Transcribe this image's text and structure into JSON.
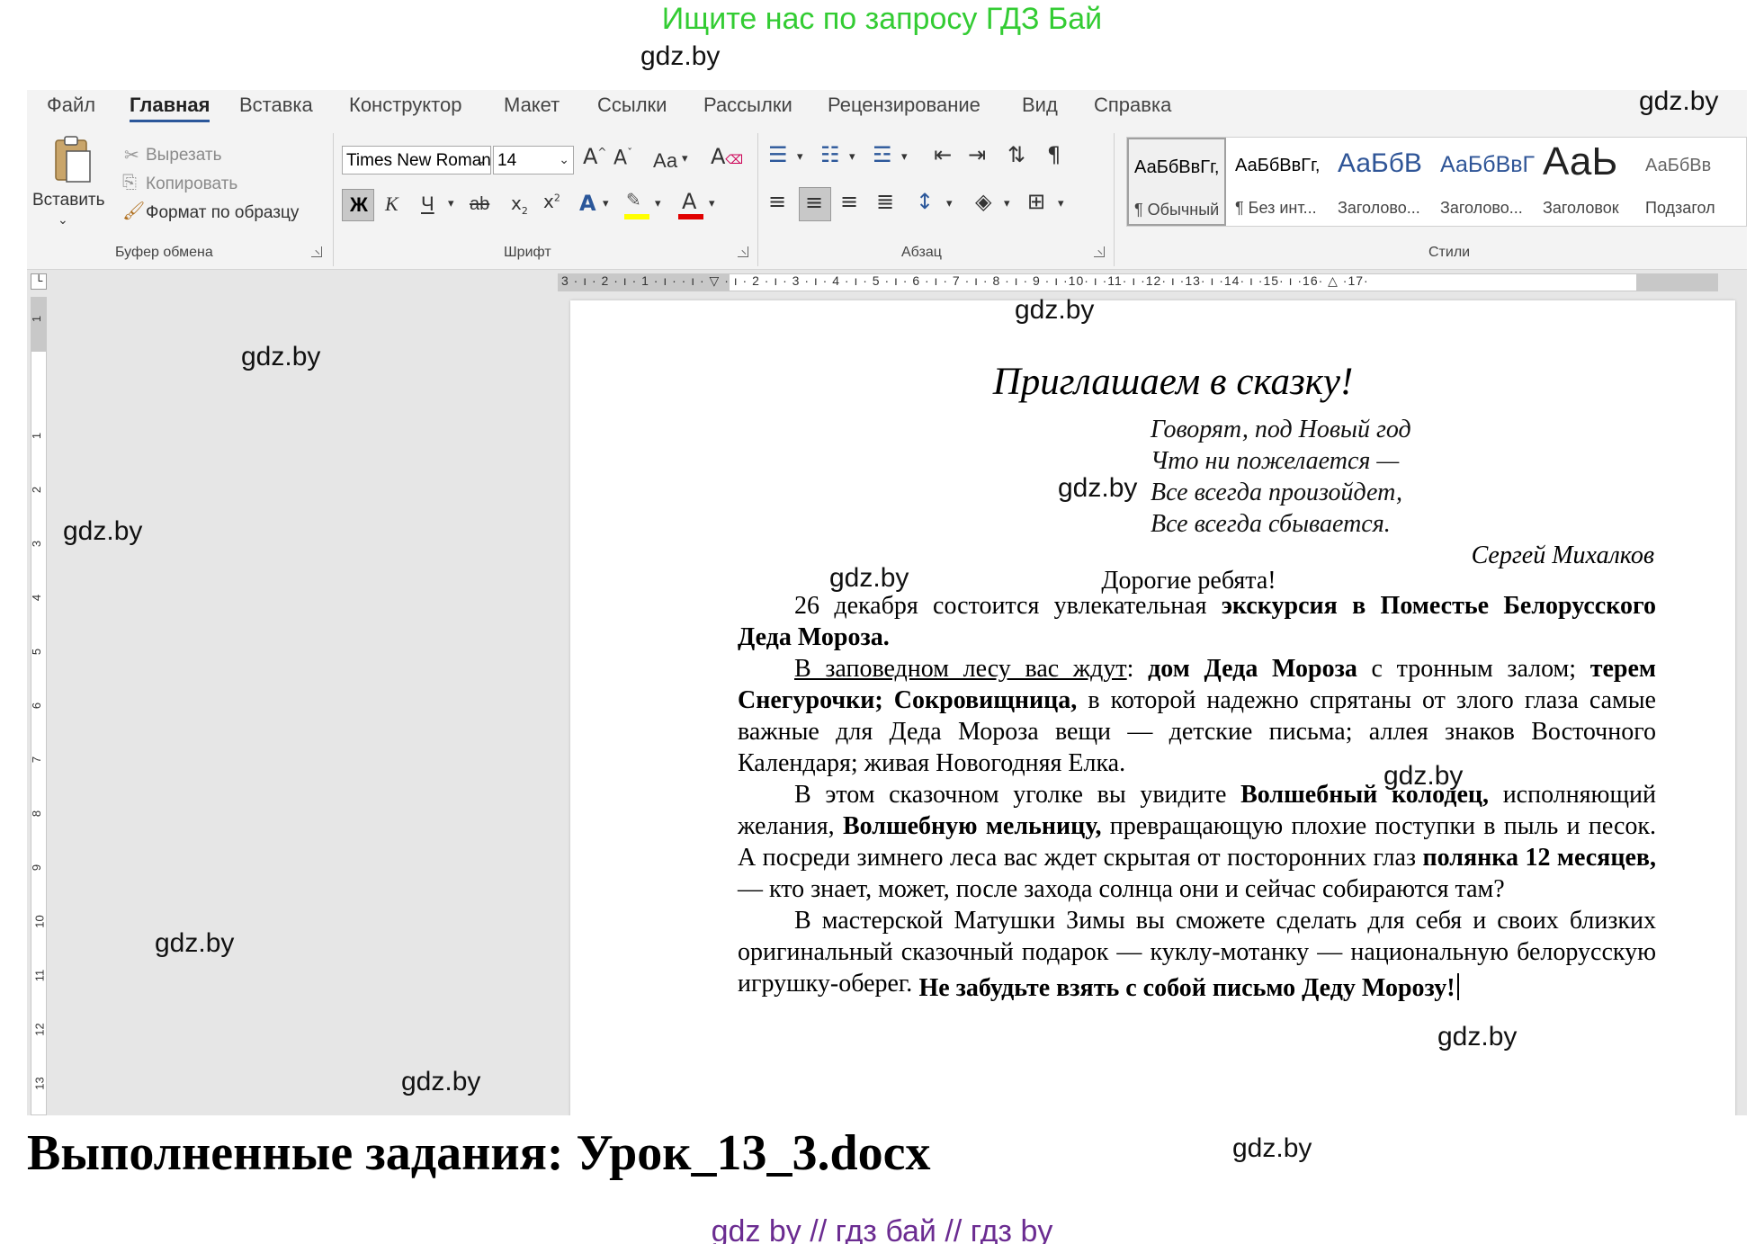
{
  "banner": "Ищите нас по запросу ГДЗ Бай",
  "watermark": "gdz.by",
  "menu": [
    "Файл",
    "Главная",
    "Вставка",
    "Конструктор",
    "Макет",
    "Ссылки",
    "Рассылки",
    "Рецензирование",
    "Вид",
    "Справка"
  ],
  "clipboard": {
    "paste": "Вставить",
    "cut": "Вырезать",
    "copy": "Копировать",
    "format_painter": "Формат по образцу",
    "label": "Буфер обмена"
  },
  "font": {
    "name": "Times New Roman",
    "size": "14",
    "case_label": "Аа",
    "bold": "Ж",
    "italic": "К",
    "underline": "Ч",
    "strike": "ab",
    "label": "Шрифт"
  },
  "paragraph": {
    "label": "Абзац"
  },
  "styles": {
    "label": "Стили",
    "items": [
      {
        "sample": "АаБбВвГг,",
        "name": "¶ Обычный"
      },
      {
        "sample": "АаБбВвГг,",
        "name": "¶ Без инт..."
      },
      {
        "sample": "АаБбВ",
        "name": "Заголово..."
      },
      {
        "sample": "АаБбВвГ",
        "name": "Заголово..."
      },
      {
        "sample": "АаЬ",
        "name": "Заголовок"
      },
      {
        "sample": "АаБбВв",
        "name": "Подзагол"
      }
    ]
  },
  "ruler": {
    "h_numbers": "3 · ı · 2 · ı · 1 · ı ·   · ı · ▽ · ı · 2 · ı · 3 · ı · 4 · ı · 5 · ı · 6 · ı · 7 · ı · 8 · ı · 9 · ı ·10· ı ·11· ı ·12· ı ·13· ı ·14· ı ·15· ı ·16· △ ·17·",
    "v_numbers": [
      "1",
      "1",
      "2",
      "3",
      "4",
      "5",
      "6",
      "7",
      "8",
      "9",
      "10",
      "11",
      "12",
      "13"
    ]
  },
  "document": {
    "title": "Приглашаем в сказку!",
    "poem": [
      "Говорят, под Новый год",
      "Что ни пожелается —",
      "Все всегда произойдет,",
      "Все всегда сбывается."
    ],
    "author": "Сергей Михалков",
    "greeting": "Дорогие ребята!",
    "p1": {
      "a": "26 декабря состоится увлекательная ",
      "b": "экскурсия в Поместье Белорусского Деда Мороза."
    },
    "p2": {
      "u": "В заповедном лесу вас ждут",
      "a": ": ",
      "b1": "дом Деда Мороза",
      "c": " с тронным залом; ",
      "b2": "терем Снегурочки; Сокровищница,",
      "d": " в которой надежно спрятаны от злого глаза самые важные для Деда Мороза вещи — детские письма; аллея знаков Восточного Календаря; живая Новогодняя Елка."
    },
    "p3": {
      "a": "В этом сказочном уголке вы увидите ",
      "b1": "Волшебный колодец,",
      "c": " исполняющий желания, ",
      "b2": "Волшебную мельницу,",
      "d": " превращающую плохие поступки в пыль и песок. А посреди зимнего леса вас ждет скрытая от посторонних глаз ",
      "b3": "полянка 12 месяцев,",
      "e": " — кто знает, может, после захода солнца они и сейчас собираются там?"
    },
    "p4": "В мастерской Матушки Зимы вы сможете сделать для себя и своих близких оригинальный сказочный подарок — куклу-мотанку — национальную белорусскую игрушку-оберег.",
    "closing": "Не забудьте взять с собой письмо Деду Морозу!"
  },
  "caption": "Выполненные задания: Урок_13_3.docx",
  "footer_links": "gdz by  //  гдз бай  //  гдз by"
}
